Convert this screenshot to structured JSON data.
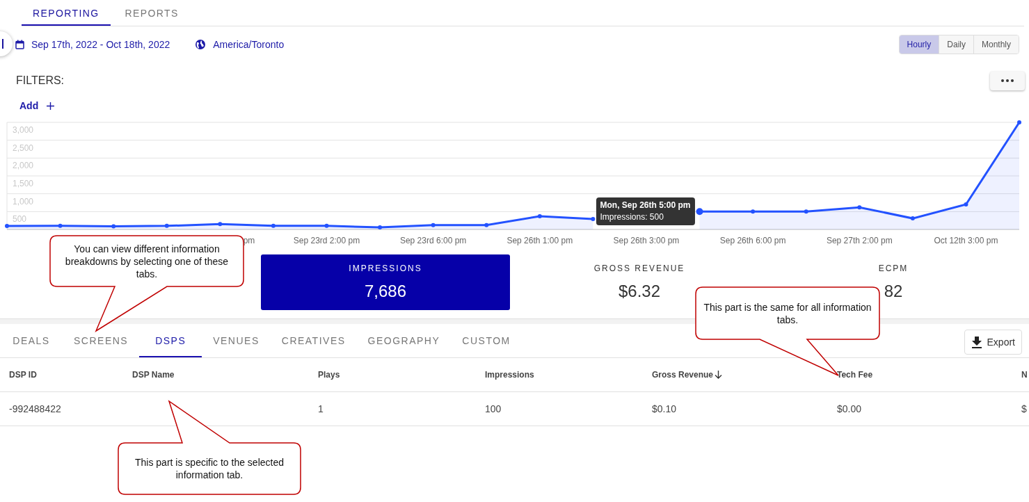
{
  "top_tabs": [
    {
      "label": "REPORTING",
      "selected": true
    },
    {
      "label": "REPORTS",
      "selected": false
    }
  ],
  "date_range": "Sep 17th, 2022 - Oct 18th, 2022",
  "timezone": "America/Toronto",
  "granularity": [
    {
      "label": "Hourly",
      "selected": true
    },
    {
      "label": "Daily",
      "selected": false
    },
    {
      "label": "Monthly",
      "selected": false
    }
  ],
  "filters": {
    "title": "FILTERS:",
    "add_label": "Add"
  },
  "chart": {
    "chart_data": {
      "type": "area",
      "grid": true,
      "categories": [
        null,
        null,
        null,
        null,
        null,
        null,
        "Sep 23rd 2:00 pm",
        null,
        "Sep 23rd 6:00 pm",
        null,
        "Sep 26th 1:00 pm",
        null,
        "Sep 26th 3:00 pm",
        null,
        "Sep 26th 6:00 pm",
        null,
        "Sep 27th 2:00 pm",
        null,
        "Oct 12th 3:00 pm",
        null
      ],
      "series": [
        {
          "color": "#2352ff",
          "values": [
            95,
            100,
            90,
            100,
            150,
            100,
            100,
            60,
            120,
            120,
            370,
            290,
            null,
            500,
            500,
            500,
            620,
            310,
            700,
            3000
          ]
        }
      ],
      "ylim": [
        0,
        3000
      ],
      "yticks": [
        {
          "value": 500,
          "label": "500"
        },
        {
          "value": 1000,
          "label": "1,000"
        },
        {
          "value": 1500,
          "label": "1,500"
        },
        {
          "value": 2000,
          "label": "2,000"
        },
        {
          "value": 2500,
          "label": "2,500"
        },
        {
          "value": 3000,
          "label": "3,000"
        }
      ]
    },
    "cut_tick_label": "pm",
    "tooltip": {
      "title": "Mon, Sep 26th 5:00 pm",
      "text": "Impressions: 500"
    }
  },
  "stats": [
    {
      "label": "IMPRESSIONS",
      "value": "7,686",
      "selected": true
    },
    {
      "label": "GROSS REVENUE",
      "value": "$6.32",
      "selected": false
    },
    {
      "label": "ECPM",
      "value": "82",
      "selected": false
    }
  ],
  "info_tabs": [
    {
      "label": "DEALS",
      "selected": false
    },
    {
      "label": "SCREENS",
      "selected": false
    },
    {
      "label": "DSPS",
      "selected": true
    },
    {
      "label": "VENUES",
      "selected": false
    },
    {
      "label": "CREATIVES",
      "selected": false
    },
    {
      "label": "GEOGRAPHY",
      "selected": false
    },
    {
      "label": "CUSTOM",
      "selected": false
    }
  ],
  "export_button": "Export",
  "table": {
    "columns": [
      {
        "label": "DSP ID",
        "sorted": false
      },
      {
        "label": "DSP Name",
        "sorted": false
      },
      {
        "label": "Plays",
        "sorted": false
      },
      {
        "label": "Impressions",
        "sorted": false
      },
      {
        "label": "Gross Revenue",
        "sorted": true
      },
      {
        "label": "Tech Fee",
        "sorted": false
      },
      {
        "label": "N",
        "sorted": false
      }
    ],
    "rows": [
      [
        "-992488422",
        null,
        "1",
        "100",
        "$0.10",
        "$0.00",
        "$"
      ]
    ]
  },
  "callouts": [
    {
      "text": "You can view different information breakdowns by selecting one of these tabs."
    },
    {
      "text": "This part is the same for all information tabs."
    },
    {
      "text": "This part is specific to the selected information tab."
    }
  ]
}
